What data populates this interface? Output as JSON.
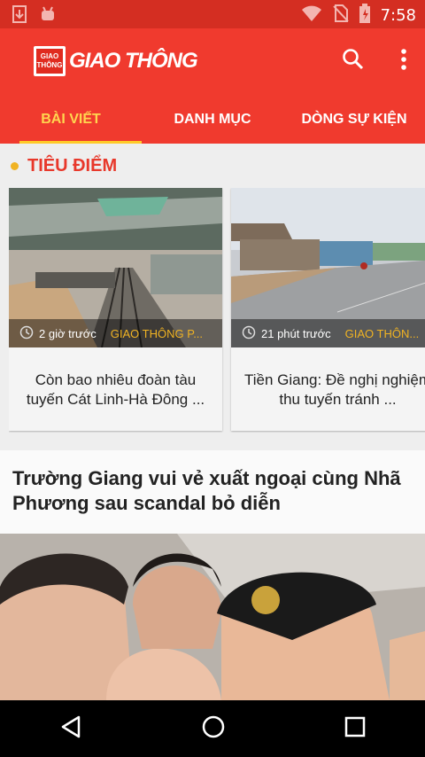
{
  "status_bar": {
    "time": "7:58",
    "icons": [
      "download-icon",
      "android-icon",
      "wifi-icon",
      "no-sim-icon",
      "battery-icon"
    ]
  },
  "app_bar": {
    "logo_badge_line1": "GIAO",
    "logo_badge_line2": "THÔNG",
    "logo_text": "GIAO THÔNG",
    "actions": [
      "search-icon",
      "more-vert-icon"
    ]
  },
  "tabs": [
    {
      "label": "BÀI VIẾT",
      "active": true
    },
    {
      "label": "DANH MỤC",
      "active": false
    },
    {
      "label": "DÒNG SỰ KIỆN",
      "active": false
    }
  ],
  "section": {
    "title": "TIÊU ĐIỂM"
  },
  "featured": [
    {
      "time": "2 giờ trước",
      "source": "GIAO THÔNG P...",
      "title": "Còn bao nhiêu đoàn tàu tuyến Cát Linh-Hà Đông ..."
    },
    {
      "time": "21 phút trước",
      "source": "GIAO THÔN...",
      "title": "Tiền Giang: Đề nghị nghiệm thu tuyến tránh ..."
    }
  ],
  "article": {
    "title": "Trường Giang vui vẻ xuất ngoại cùng Nhã Phương sau scandal bỏ diễn"
  },
  "colors": {
    "status_bar": "#d42e22",
    "app_bar": "#f03a2e",
    "tab_active": "#ffd54f",
    "accent": "#f0b323",
    "section_title": "#e8382b"
  },
  "nav_bar": [
    "back-icon",
    "home-icon",
    "recents-icon"
  ]
}
